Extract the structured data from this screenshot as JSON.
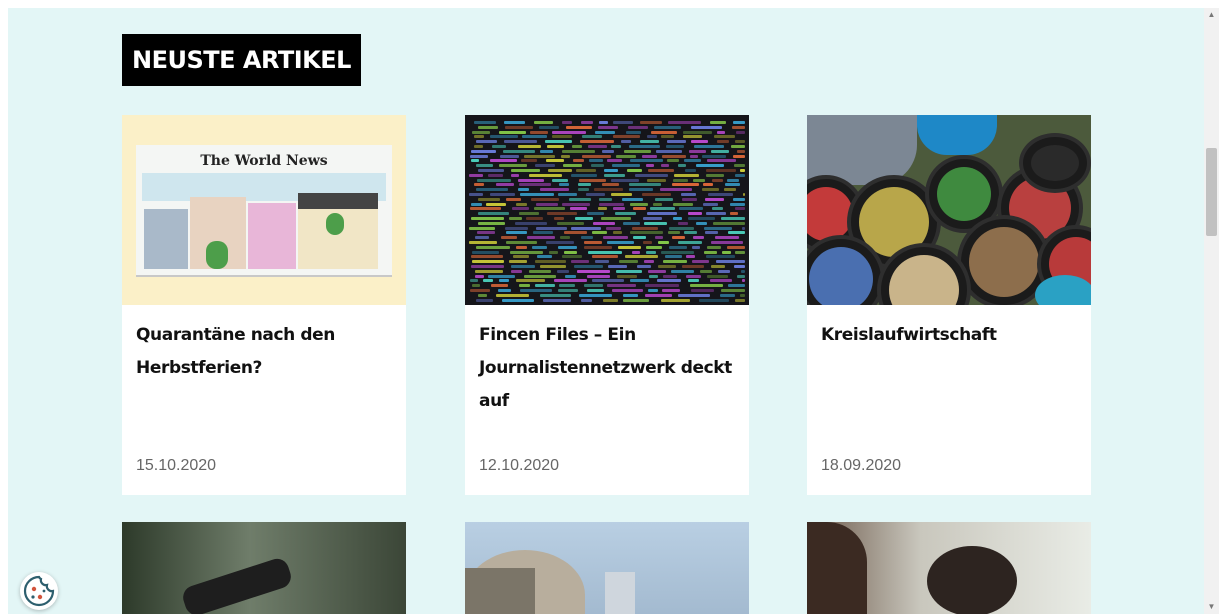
{
  "section": {
    "heading": "NEUSTE ARTIKEL"
  },
  "articles": [
    {
      "title": "Quarantäne nach den Herbstferien?",
      "date": "15.10.2020",
      "thumb_text": "The World News"
    },
    {
      "title": "Fincen Files – Ein Journalistennetzwerk deckt auf",
      "date": "12.10.2020"
    },
    {
      "title": "Kreislaufwirtschaft",
      "date": "18.09.2020"
    }
  ],
  "colors": {
    "page_bg": "#e3f6f6",
    "heading_bg": "#000000",
    "card_bg": "#ffffff",
    "date_color": "#666666"
  },
  "icons": {
    "cookie": "cookie-icon",
    "scroll_up": "chevron-up-icon",
    "scroll_down": "chevron-down-icon"
  }
}
